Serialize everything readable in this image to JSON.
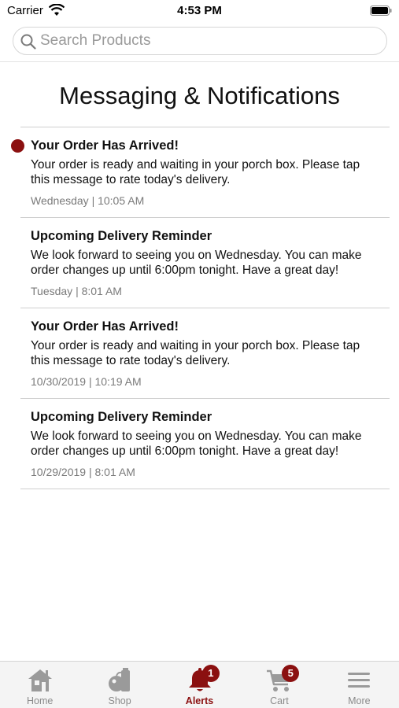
{
  "status_bar": {
    "carrier": "Carrier",
    "time": "4:53 PM"
  },
  "search": {
    "placeholder": "Search Products"
  },
  "page": {
    "title": "Messaging & Notifications"
  },
  "notifications": [
    {
      "title": "Your Order Has Arrived!",
      "body": "Your order is ready and waiting in your porch box. Please tap this message to rate today's delivery.",
      "time": "Wednesday | 10:05 AM",
      "unread": true
    },
    {
      "title": "Upcoming Delivery Reminder",
      "body": "We look forward to seeing you on Wednesday. You can make order changes up until 6:00pm tonight. Have a great day!",
      "time": "Tuesday | 8:01 AM",
      "unread": false
    },
    {
      "title": "Your Order Has Arrived!",
      "body": "Your order is ready and waiting in your porch box. Please tap this message to rate today's delivery.",
      "time": "10/30/2019 | 10:19 AM",
      "unread": false
    },
    {
      "title": "Upcoming Delivery Reminder",
      "body": "We look forward to seeing you on Wednesday. You can make order changes up until 6:00pm tonight. Have a great day!",
      "time": "10/29/2019 | 8:01 AM",
      "unread": false
    }
  ],
  "tab_bar": {
    "tabs": [
      {
        "label": "Home",
        "icon": "home-icon"
      },
      {
        "label": "Shop",
        "icon": "shop-icon"
      },
      {
        "label": "Alerts",
        "icon": "bell-icon",
        "badge": "1",
        "active": true
      },
      {
        "label": "Cart",
        "icon": "cart-icon",
        "badge": "5"
      },
      {
        "label": "More",
        "icon": "menu-icon"
      }
    ]
  },
  "colors": {
    "accent": "#8b1010",
    "inactive_tab": "#8a8a8a",
    "divider": "#cfcfcf",
    "timestamp": "#7a7a7a"
  }
}
